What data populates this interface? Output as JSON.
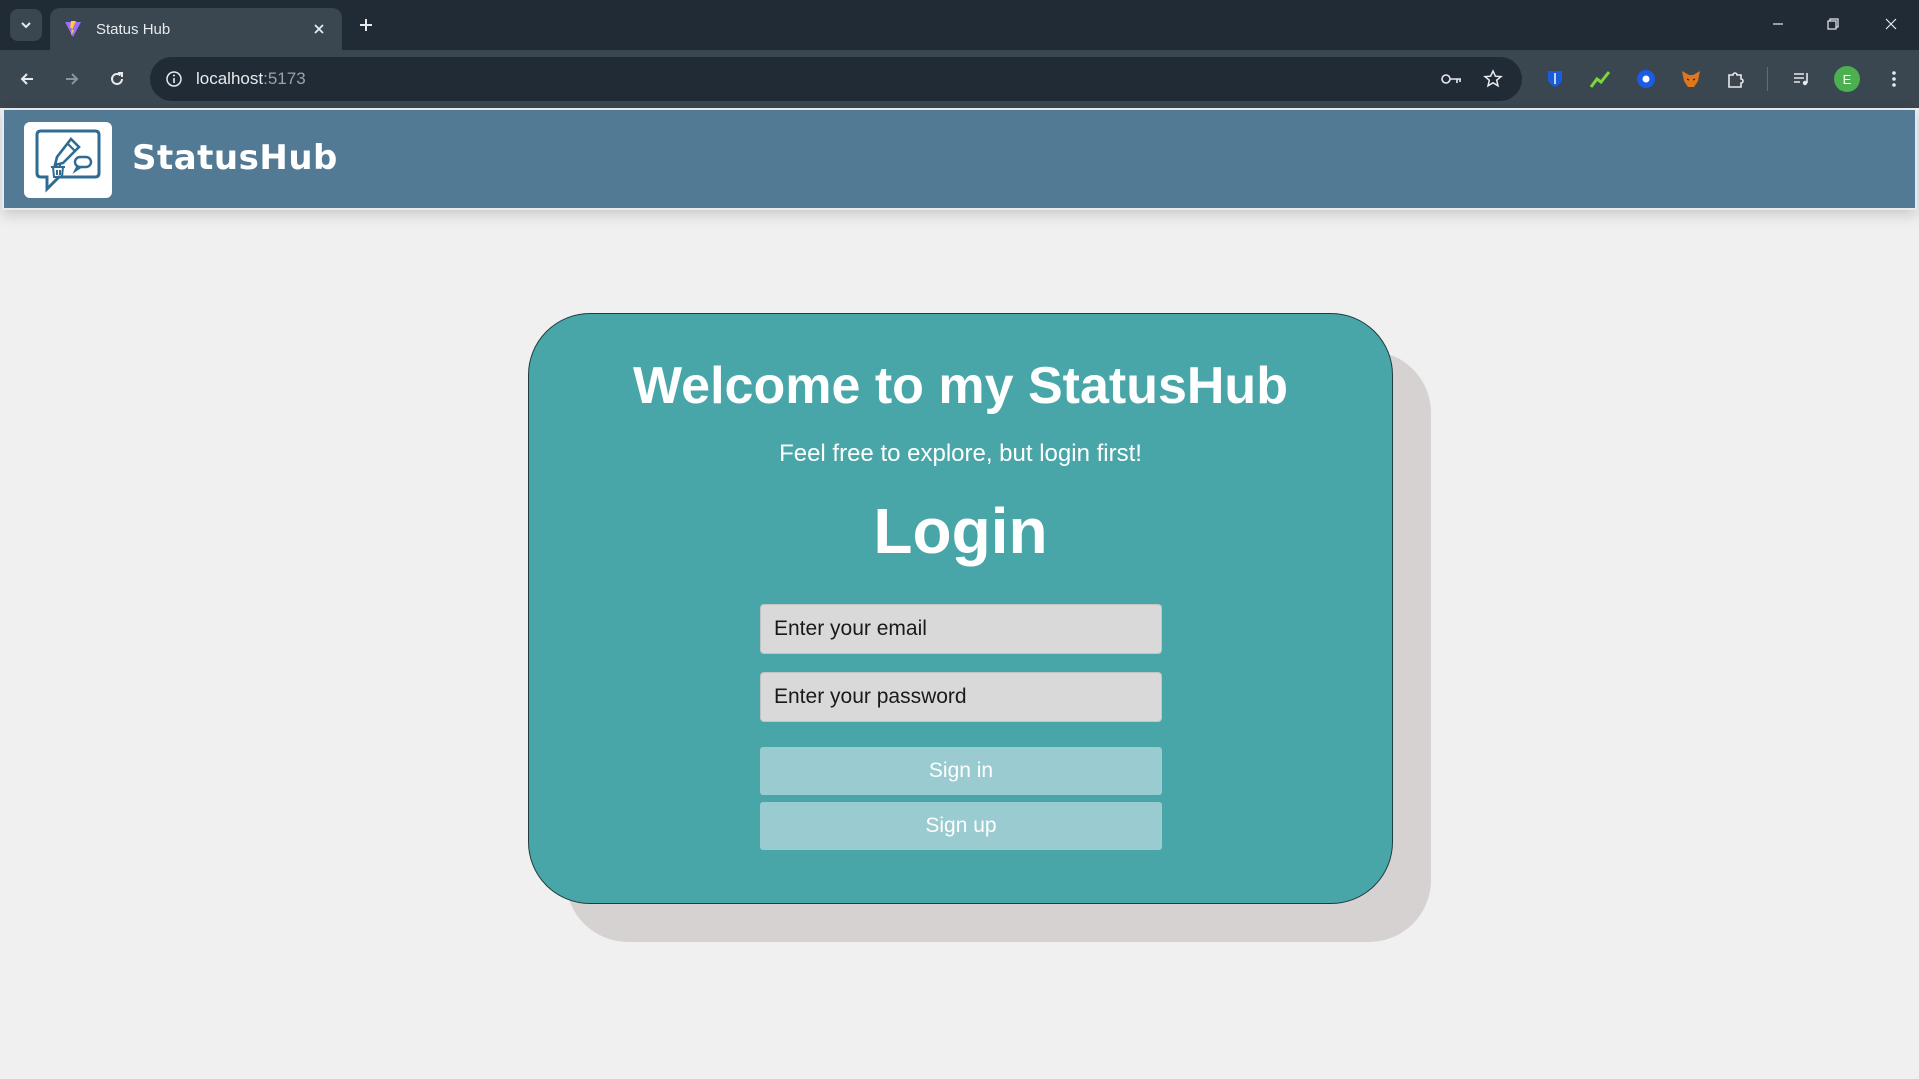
{
  "browser": {
    "tab_title": "Status Hub",
    "url_host": "localhost",
    "url_port": ":5173",
    "profile_initial": "E"
  },
  "app": {
    "brand": "StatusHub",
    "accent_color": "#537a95",
    "card_color": "#49a6a8"
  },
  "login": {
    "welcome": "Welcome to my StatusHub",
    "subtitle": "Feel free to explore, but login first!",
    "heading": "Login",
    "email_placeholder": "Enter your email",
    "password_placeholder": "Enter your password",
    "sign_in_label": "Sign in",
    "sign_up_label": "Sign up"
  },
  "icons": {
    "tab_list": "chevron-down-icon",
    "favicon": "vite-icon",
    "close": "close-icon",
    "new_tab": "plus-icon",
    "back": "arrow-left-icon",
    "forward": "arrow-right-icon",
    "reload": "reload-icon",
    "site_info": "info-icon",
    "passwords": "key-icon",
    "bookmark": "star-icon",
    "extensions": "puzzle-icon",
    "media": "media-control-icon",
    "menu": "kebab-menu-icon",
    "logo": "pencil-chat-icon"
  }
}
